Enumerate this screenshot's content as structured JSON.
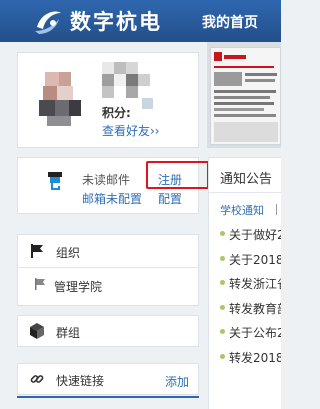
{
  "header": {
    "logo_text": "数字杭电",
    "nav_home": "我的首页",
    "color": "#2f67ae"
  },
  "profile": {
    "points_label": "积分:",
    "friends_link": "查看好友››"
  },
  "mail": {
    "unread_label": "未读邮件",
    "mailbox_link": "邮箱未配置",
    "register_link": "注册",
    "config_link": "配置"
  },
  "organization": {
    "title": "组织",
    "items": [
      {
        "label": "管理学院"
      }
    ]
  },
  "group": {
    "title": "群组"
  },
  "quick_links": {
    "title": "快速链接",
    "add_link": "添加"
  },
  "notice": {
    "title": "通知公告",
    "tab": "学校通知",
    "items": [
      {
        "text": "关于做好2"
      },
      {
        "text": "关于2018"
      },
      {
        "text": "转发浙江省"
      },
      {
        "text": "转发教育部"
      },
      {
        "text": "关于公布2"
      },
      {
        "text": "转发2018"
      }
    ]
  },
  "icons": [
    "logo-icon",
    "mail-icon",
    "flag-icon",
    "flag-small-icon",
    "cube-icon",
    "link-icon"
  ]
}
